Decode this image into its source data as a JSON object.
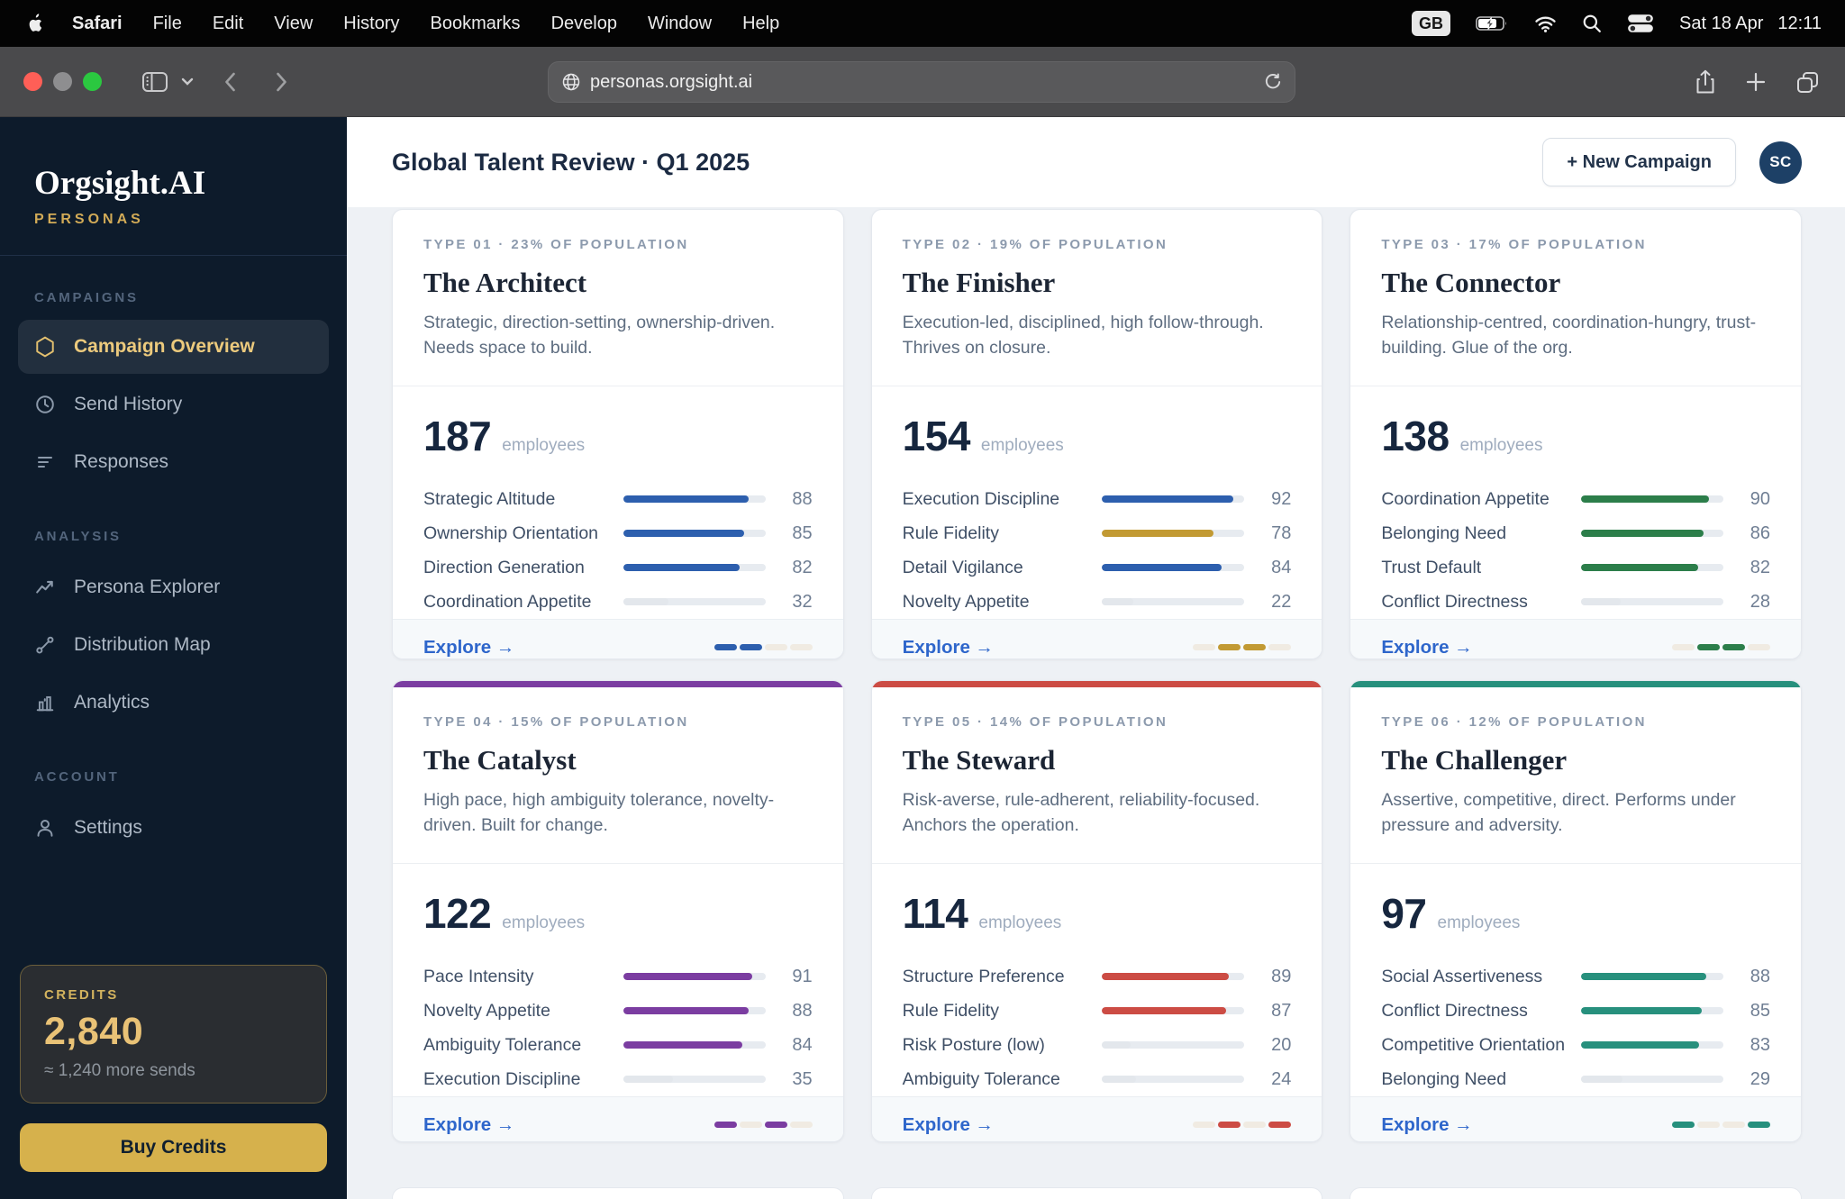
{
  "menubar": {
    "apple_icon": "apple-icon",
    "items": [
      {
        "label": "Safari",
        "bold": true
      },
      {
        "label": "File"
      },
      {
        "label": "Edit"
      },
      {
        "label": "View"
      },
      {
        "label": "History"
      },
      {
        "label": "Bookmarks"
      },
      {
        "label": "Develop"
      },
      {
        "label": "Window"
      },
      {
        "label": "Help"
      }
    ],
    "status": {
      "input_source": "GB",
      "date": "Sat 18 Apr",
      "time": "12:11"
    }
  },
  "browser": {
    "url": "personas.orgsight.ai"
  },
  "sidebar": {
    "logo_title": "Orgsight.AI",
    "logo_subtitle": "PERSONAS",
    "sections": [
      {
        "label": "CAMPAIGNS",
        "items": [
          {
            "label": "Campaign Overview",
            "icon": "hexagon-icon",
            "active": true
          },
          {
            "label": "Send History",
            "icon": "clock-icon"
          },
          {
            "label": "Responses",
            "icon": "list-icon"
          }
        ]
      },
      {
        "label": "ANALYSIS",
        "items": [
          {
            "label": "Persona Explorer",
            "icon": "trend-icon"
          },
          {
            "label": "Distribution Map",
            "icon": "path-icon"
          },
          {
            "label": "Analytics",
            "icon": "bar-chart-icon"
          }
        ]
      },
      {
        "label": "ACCOUNT",
        "items": [
          {
            "label": "Settings",
            "icon": "person-icon"
          }
        ]
      }
    ],
    "credits": {
      "label": "CREDITS",
      "amount": "2,840",
      "note": "≈ 1,240 more sends",
      "buy_label": "Buy Credits"
    }
  },
  "header": {
    "title": "Global Talent Review · Q1 2025",
    "new_campaign_label": "+ New Campaign",
    "avatar_initials": "SC"
  },
  "theme": {
    "blue": "#2d5fae",
    "gold": "#c29a33",
    "green": "#2c7e4a",
    "purple": "#7b3da1",
    "red": "#cc4c44",
    "teal": "#27907d",
    "dim_fill": "#e3e7ec",
    "mini_light": "#f0ebe2",
    "sidebar_bg": "#0d1b2b",
    "accent_gold": "#d6b14c",
    "link_blue": "#2e66cb",
    "traffic_red": "#ff5f57",
    "traffic_mid": "#8e8e90",
    "traffic_green": "#2bc840"
  },
  "cards": [
    {
      "type_label": "TYPE 01 · 23% OF POPULATION",
      "title": "The Architect",
      "description": "Strategic, direction-setting, ownership-driven. Needs space to build.",
      "count": "187",
      "count_suffix": "employees",
      "accent": "blue",
      "accent_bar": false,
      "explore_label": "Explore →",
      "stats": [
        {
          "label": "Strategic Altitude",
          "value": 88,
          "color": "blue"
        },
        {
          "label": "Ownership Orientation",
          "value": 85,
          "color": "blue"
        },
        {
          "label": "Direction Generation",
          "value": 82,
          "color": "blue"
        },
        {
          "label": "Coordination Appetite",
          "value": 32,
          "color": "dim"
        }
      ],
      "mini_pattern": [
        1,
        1,
        0,
        0
      ]
    },
    {
      "type_label": "TYPE 02 · 19% OF POPULATION",
      "title": "The Finisher",
      "description": "Execution-led, disciplined, high follow-through. Thrives on closure.",
      "count": "154",
      "count_suffix": "employees",
      "accent": "gold",
      "accent_bar": false,
      "explore_label": "Explore →",
      "stats": [
        {
          "label": "Execution Discipline",
          "value": 92,
          "color": "blue"
        },
        {
          "label": "Rule Fidelity",
          "value": 78,
          "color": "gold"
        },
        {
          "label": "Detail Vigilance",
          "value": 84,
          "color": "blue"
        },
        {
          "label": "Novelty Appetite",
          "value": 22,
          "color": "dim"
        }
      ],
      "mini_pattern": [
        0,
        1,
        1,
        0
      ]
    },
    {
      "type_label": "TYPE 03 · 17% OF POPULATION",
      "title": "The Connector",
      "description": "Relationship-centred, coordination-hungry, trust-building. Glue of the org.",
      "count": "138",
      "count_suffix": "employees",
      "accent": "green",
      "accent_bar": false,
      "explore_label": "Explore →",
      "stats": [
        {
          "label": "Coordination Appetite",
          "value": 90,
          "color": "green"
        },
        {
          "label": "Belonging Need",
          "value": 86,
          "color": "green"
        },
        {
          "label": "Trust Default",
          "value": 82,
          "color": "green"
        },
        {
          "label": "Conflict Directness",
          "value": 28,
          "color": "dim"
        }
      ],
      "mini_pattern": [
        0,
        1,
        1,
        0
      ]
    },
    {
      "type_label": "TYPE 04 · 15% OF POPULATION",
      "title": "The Catalyst",
      "description": "High pace, high ambiguity tolerance, novelty-driven. Built for change.",
      "count": "122",
      "count_suffix": "employees",
      "accent": "purple",
      "accent_bar": true,
      "explore_label": "Explore →",
      "stats": [
        {
          "label": "Pace Intensity",
          "value": 91,
          "color": "purple"
        },
        {
          "label": "Novelty Appetite",
          "value": 88,
          "color": "purple"
        },
        {
          "label": "Ambiguity Tolerance",
          "value": 84,
          "color": "purple"
        },
        {
          "label": "Execution Discipline",
          "value": 35,
          "color": "dim"
        }
      ],
      "mini_pattern": [
        1,
        0,
        1,
        0
      ]
    },
    {
      "type_label": "TYPE 05 · 14% OF POPULATION",
      "title": "The Steward",
      "description": "Risk-averse, rule-adherent, reliability-focused. Anchors the operation.",
      "count": "114",
      "count_suffix": "employees",
      "accent": "red",
      "accent_bar": true,
      "explore_label": "Explore →",
      "stats": [
        {
          "label": "Structure Preference",
          "value": 89,
          "color": "red"
        },
        {
          "label": "Rule Fidelity",
          "value": 87,
          "color": "red"
        },
        {
          "label": "Risk Posture (low)",
          "value": 20,
          "color": "dim"
        },
        {
          "label": "Ambiguity Tolerance",
          "value": 24,
          "color": "dim"
        }
      ],
      "mini_pattern": [
        0,
        1,
        0,
        1
      ]
    },
    {
      "type_label": "TYPE 06 · 12% OF POPULATION",
      "title": "The Challenger",
      "description": "Assertive, competitive, direct. Performs under pressure and adversity.",
      "count": "97",
      "count_suffix": "employees",
      "accent": "teal",
      "accent_bar": true,
      "explore_label": "Explore →",
      "stats": [
        {
          "label": "Social Assertiveness",
          "value": 88,
          "color": "teal"
        },
        {
          "label": "Conflict Directness",
          "value": 85,
          "color": "teal"
        },
        {
          "label": "Competitive Orientation",
          "value": 83,
          "color": "teal"
        },
        {
          "label": "Belonging Need",
          "value": 29,
          "color": "dim"
        }
      ],
      "mini_pattern": [
        1,
        0,
        0,
        1
      ]
    }
  ]
}
